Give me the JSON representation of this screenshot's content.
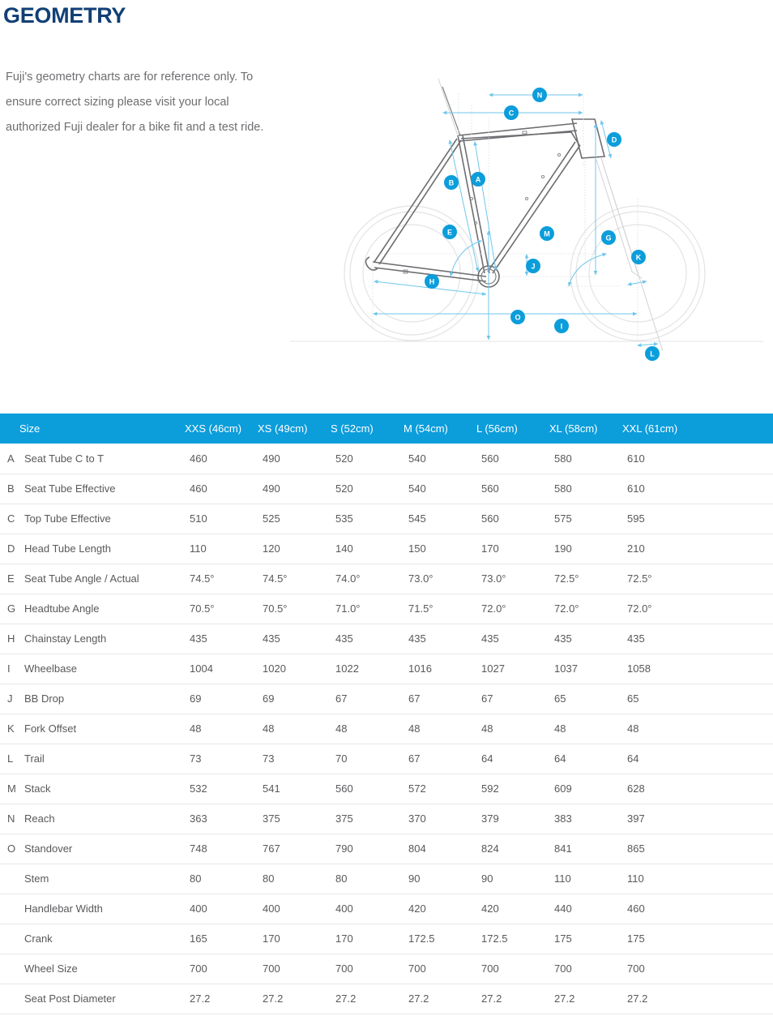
{
  "page": {
    "title": "GEOMETRY",
    "intro": "Fuji's geometry charts are for reference only. To ensure correct sizing please visit your local authorized Fuji dealer for a bike fit and a test ride.",
    "title_color": "#123f76",
    "accent_color": "#0c9ddb",
    "text_color": "#58595b"
  },
  "diagram": {
    "name": "bicycle-geometry-diagram",
    "callouts": [
      {
        "id": "A",
        "label": "A",
        "meaning": "Seat Tube C to T"
      },
      {
        "id": "B",
        "label": "B",
        "meaning": "Seat Tube Effective"
      },
      {
        "id": "C",
        "label": "C",
        "meaning": "Top Tube Effective"
      },
      {
        "id": "D",
        "label": "D",
        "meaning": "Head Tube Length"
      },
      {
        "id": "E",
        "label": "E",
        "meaning": "Seat Tube Angle / Actual"
      },
      {
        "id": "G",
        "label": "G",
        "meaning": "Headtube Angle"
      },
      {
        "id": "H",
        "label": "H",
        "meaning": "Chainstay Length"
      },
      {
        "id": "I",
        "label": "I",
        "meaning": "Wheelbase"
      },
      {
        "id": "J",
        "label": "J",
        "meaning": "BB Drop"
      },
      {
        "id": "K",
        "label": "K",
        "meaning": "Fork Offset"
      },
      {
        "id": "L",
        "label": "L",
        "meaning": "Trail"
      },
      {
        "id": "M",
        "label": "M",
        "meaning": "Stack"
      },
      {
        "id": "N",
        "label": "N",
        "meaning": "Reach"
      },
      {
        "id": "O",
        "label": "O",
        "meaning": "Standover"
      }
    ]
  },
  "chart_data": {
    "type": "table",
    "title": "GEOMETRY",
    "columns": [
      "",
      "Size",
      "XXS (46cm)",
      "XS (49cm)",
      "S (52cm)",
      "M (54cm)",
      "L (56cm)",
      "XL (58cm)",
      "XXL (61cm)"
    ],
    "rows": [
      {
        "letter": "A",
        "name": "Seat Tube C to T",
        "values": [
          "460",
          "490",
          "520",
          "540",
          "560",
          "580",
          "610"
        ]
      },
      {
        "letter": "B",
        "name": "Seat Tube Effective",
        "values": [
          "460",
          "490",
          "520",
          "540",
          "560",
          "580",
          "610"
        ]
      },
      {
        "letter": "C",
        "name": "Top Tube Effective",
        "values": [
          "510",
          "525",
          "535",
          "545",
          "560",
          "575",
          "595"
        ]
      },
      {
        "letter": "D",
        "name": "Head Tube Length",
        "values": [
          "110",
          "120",
          "140",
          "150",
          "170",
          "190",
          "210"
        ]
      },
      {
        "letter": "E",
        "name": "Seat Tube Angle / Actual",
        "values": [
          "74.5°",
          "74.5°",
          "74.0°",
          "73.0°",
          "73.0°",
          "72.5°",
          "72.5°"
        ]
      },
      {
        "letter": "G",
        "name": "Headtube Angle",
        "values": [
          "70.5°",
          "70.5°",
          "71.0°",
          "71.5°",
          "72.0°",
          "72.0°",
          "72.0°"
        ]
      },
      {
        "letter": "H",
        "name": "Chainstay Length",
        "values": [
          "435",
          "435",
          "435",
          "435",
          "435",
          "435",
          "435"
        ]
      },
      {
        "letter": "I",
        "name": "Wheelbase",
        "values": [
          "1004",
          "1020",
          "1022",
          "1016",
          "1027",
          "1037",
          "1058"
        ]
      },
      {
        "letter": "J",
        "name": "BB Drop",
        "values": [
          "69",
          "69",
          "67",
          "67",
          "67",
          "65",
          "65"
        ]
      },
      {
        "letter": "K",
        "name": "Fork Offset",
        "values": [
          "48",
          "48",
          "48",
          "48",
          "48",
          "48",
          "48"
        ]
      },
      {
        "letter": "L",
        "name": "Trail",
        "values": [
          "73",
          "73",
          "70",
          "67",
          "64",
          "64",
          "64"
        ]
      },
      {
        "letter": "M",
        "name": "Stack",
        "values": [
          "532",
          "541",
          "560",
          "572",
          "592",
          "609",
          "628"
        ]
      },
      {
        "letter": "N",
        "name": "Reach",
        "values": [
          "363",
          "375",
          "375",
          "370",
          "379",
          "383",
          "397"
        ]
      },
      {
        "letter": "O",
        "name": "Standover",
        "values": [
          "748",
          "767",
          "790",
          "804",
          "824",
          "841",
          "865"
        ]
      },
      {
        "letter": "",
        "name": "Stem",
        "values": [
          "80",
          "80",
          "80",
          "90",
          "90",
          "110",
          "110"
        ]
      },
      {
        "letter": "",
        "name": "Handlebar Width",
        "values": [
          "400",
          "400",
          "400",
          "420",
          "420",
          "440",
          "460"
        ]
      },
      {
        "letter": "",
        "name": "Crank",
        "values": [
          "165",
          "170",
          "170",
          "172.5",
          "172.5",
          "175",
          "175"
        ]
      },
      {
        "letter": "",
        "name": "Wheel Size",
        "values": [
          "700",
          "700",
          "700",
          "700",
          "700",
          "700",
          "700"
        ]
      },
      {
        "letter": "",
        "name": "Seat Post Diameter",
        "values": [
          "27.2",
          "27.2",
          "27.2",
          "27.2",
          "27.2",
          "27.2",
          "27.2"
        ]
      }
    ]
  }
}
